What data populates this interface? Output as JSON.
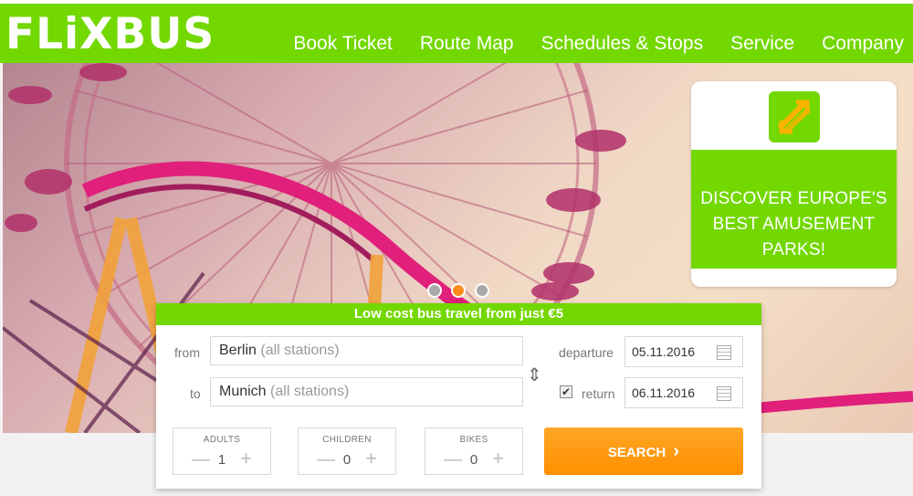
{
  "header": {
    "logo": "FLiXBUS",
    "nav": [
      "Book Ticket",
      "Route Map",
      "Schedules & Stops",
      "Service",
      "Company"
    ]
  },
  "promo": {
    "line1": "DISCOVER EUROPE'S",
    "line2": "BEST AMUSEMENT PARKS!",
    "icon": "swap-arrows-icon"
  },
  "carousel": {
    "slides": 3,
    "active_index": 1
  },
  "search": {
    "title": "Low cost bus travel from just €5",
    "from_label": "from",
    "from_value": "Berlin",
    "from_hint": "(all stations)",
    "to_label": "to",
    "to_value": "Munich",
    "to_hint": "(all stations)",
    "departure_label": "departure",
    "departure_date": "05.11.2016",
    "return_label": "return",
    "return_checked": true,
    "return_date": "06.11.2016",
    "adults_label": "ADULTS",
    "adults_value": "1",
    "children_label": "CHILDREN",
    "children_value": "0",
    "bikes_label": "BIKES",
    "bikes_value": "0",
    "search_label": "SEARCH",
    "search_chevron": "›"
  },
  "colors": {
    "brand_green": "#73d700",
    "accent_orange": "#ff8f00"
  }
}
